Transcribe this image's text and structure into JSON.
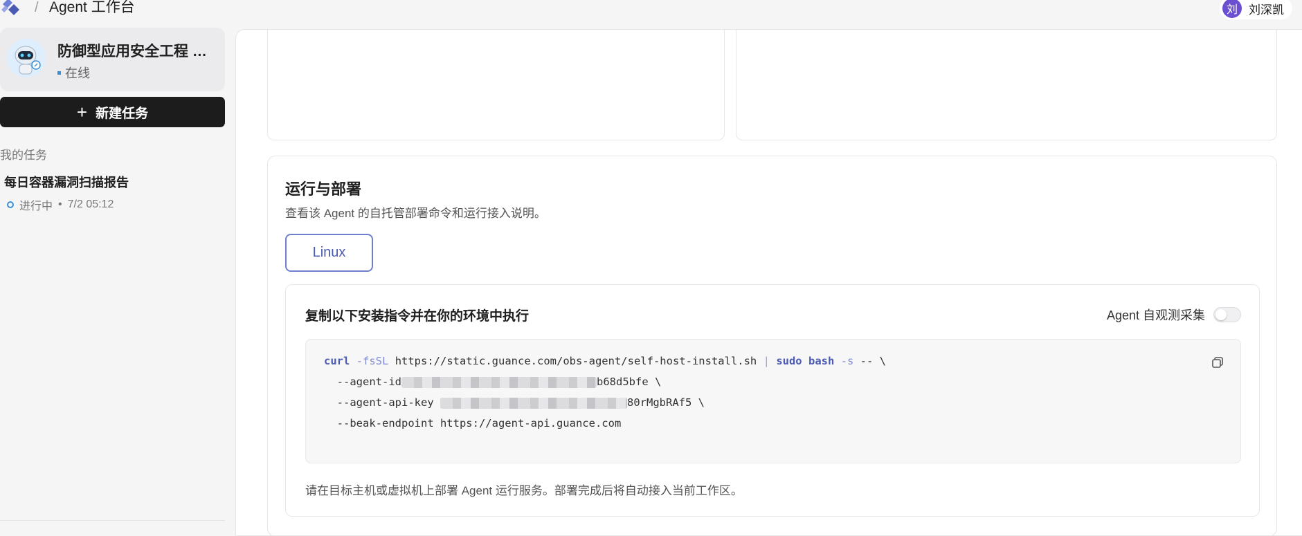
{
  "header": {
    "separator": "/",
    "title": "Agent 工作台",
    "user": {
      "initial": "刘",
      "name": "刘深凯",
      "avatar_color": "#6b4fd0"
    }
  },
  "sidebar": {
    "agent": {
      "name": "防御型应用安全工程 Agent",
      "status": "在线"
    },
    "new_task_label": "新建任务",
    "section_label": "我的任务",
    "tasks": [
      {
        "title": "每日容器漏洞扫描报告",
        "status": "进行中",
        "dot": "•",
        "time": "7/2 05:12"
      }
    ]
  },
  "deploy": {
    "title": "运行与部署",
    "description": "查看该 Agent 的自托管部署命令和运行接入说明。",
    "os_tab": "Linux",
    "install": {
      "title": "复制以下安装指令并在你的环境中执行",
      "collect_label": "Agent 自观测采集",
      "collect_enabled": false,
      "code": {
        "l1_cmd": "curl",
        "l1_flag": "-fsSL",
        "l1_url": "https://static.guance.com/obs-agent/self-host-install.sh",
        "l1_pipe": "|",
        "l1_sudo": "sudo",
        "l1_bash": "bash",
        "l1_s": "-s",
        "l1_tail": "-- \\",
        "l2_prefix": "--agent-id",
        "l2_suffix": "b68d5bfe \\",
        "l3_prefix": "--agent-api-key",
        "l3_suffix": "80rMgbRAf5 \\",
        "l4": "--beak-endpoint https://agent-api.guance.com"
      },
      "note": "请在目标主机或虚拟机上部署 Agent 运行服务。部署完成后将自动接入当前工作区。"
    }
  },
  "colors": {
    "accent": "#4b5bb3",
    "status_online": "#3a8fd9",
    "primary_button": "#1c1c1c"
  }
}
